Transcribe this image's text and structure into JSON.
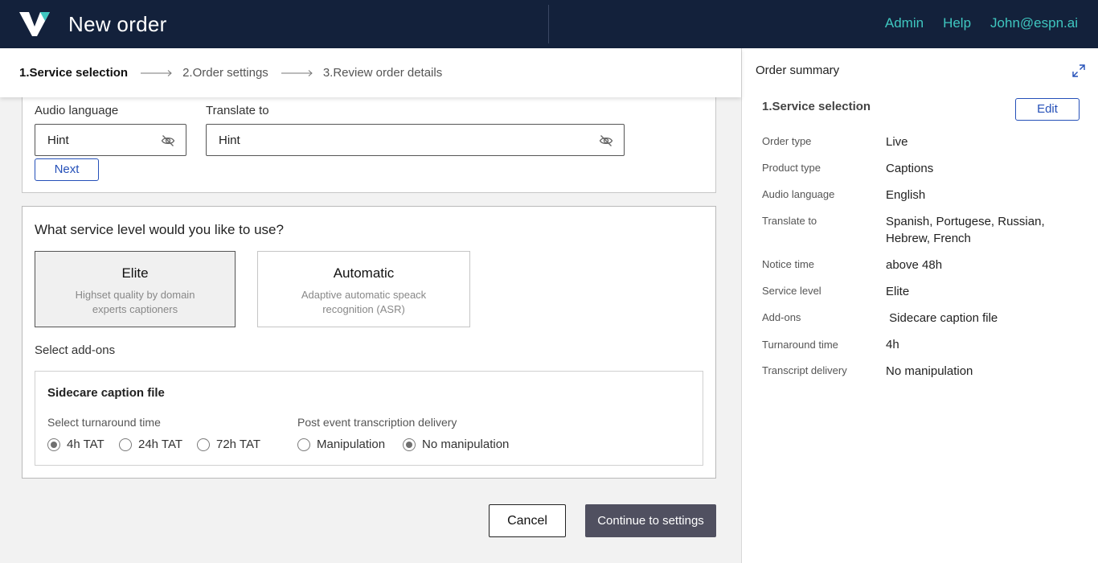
{
  "header": {
    "title": "New order",
    "nav": [
      "Admin",
      "Help",
      "John@espn.ai"
    ]
  },
  "stepper": {
    "steps": [
      "1.Service selection",
      "2.Order settings",
      "3.Review order details"
    ]
  },
  "form": {
    "audio_language_label": "Audio language",
    "audio_language_value": "Hint",
    "translate_label": "Translate to",
    "translate_value": "Hint",
    "next_label": "Next",
    "question": "What service level would you like to use?",
    "options": [
      {
        "title": "Elite",
        "desc": "Highset quality by domain experts captioners",
        "selected": true
      },
      {
        "title": "Automatic",
        "desc": "Adaptive automatic speack recognition (ASR)",
        "selected": false
      }
    ],
    "addons_label": "Select add-ons",
    "addon": {
      "title": "Sidecare caption file",
      "turnaround_label": "Select turnaround time",
      "turnaround_options": [
        "4h TAT",
        "24h TAT",
        "72h TAT"
      ],
      "turnaround_selected": "4h TAT",
      "delivery_label": "Post event transcription delivery",
      "delivery_options": [
        "Manipulation",
        "No manipulation"
      ],
      "delivery_selected": "No manipulation"
    },
    "cancel_label": "Cancel",
    "continue_label": "Continue to settings"
  },
  "summary": {
    "title": "Order summary",
    "section_title": "1.Service selection",
    "edit_label": "Edit",
    "rows": [
      {
        "label": "Order type",
        "value": "Live"
      },
      {
        "label": "Product type",
        "value": "Captions"
      },
      {
        "label": "Audio language",
        "value": "English"
      },
      {
        "label": "Translate to",
        "value": "Spanish, Portugese, Russian, Hebrew, French"
      },
      {
        "label": "Notice time",
        "value": "above 48h"
      },
      {
        "label": "Service level",
        "value": "Elite"
      },
      {
        "label": "Add-ons",
        "value": " Sidecare caption file"
      },
      {
        "label": "Turnaround time",
        "value": "4h"
      },
      {
        "label": "Transcript delivery",
        "value": "No manipulation"
      }
    ]
  },
  "colors": {
    "header_bg": "#13213b",
    "nav_link": "#3fc7c0",
    "accent_blue": "#2550b8",
    "primary_button": "#505060"
  }
}
